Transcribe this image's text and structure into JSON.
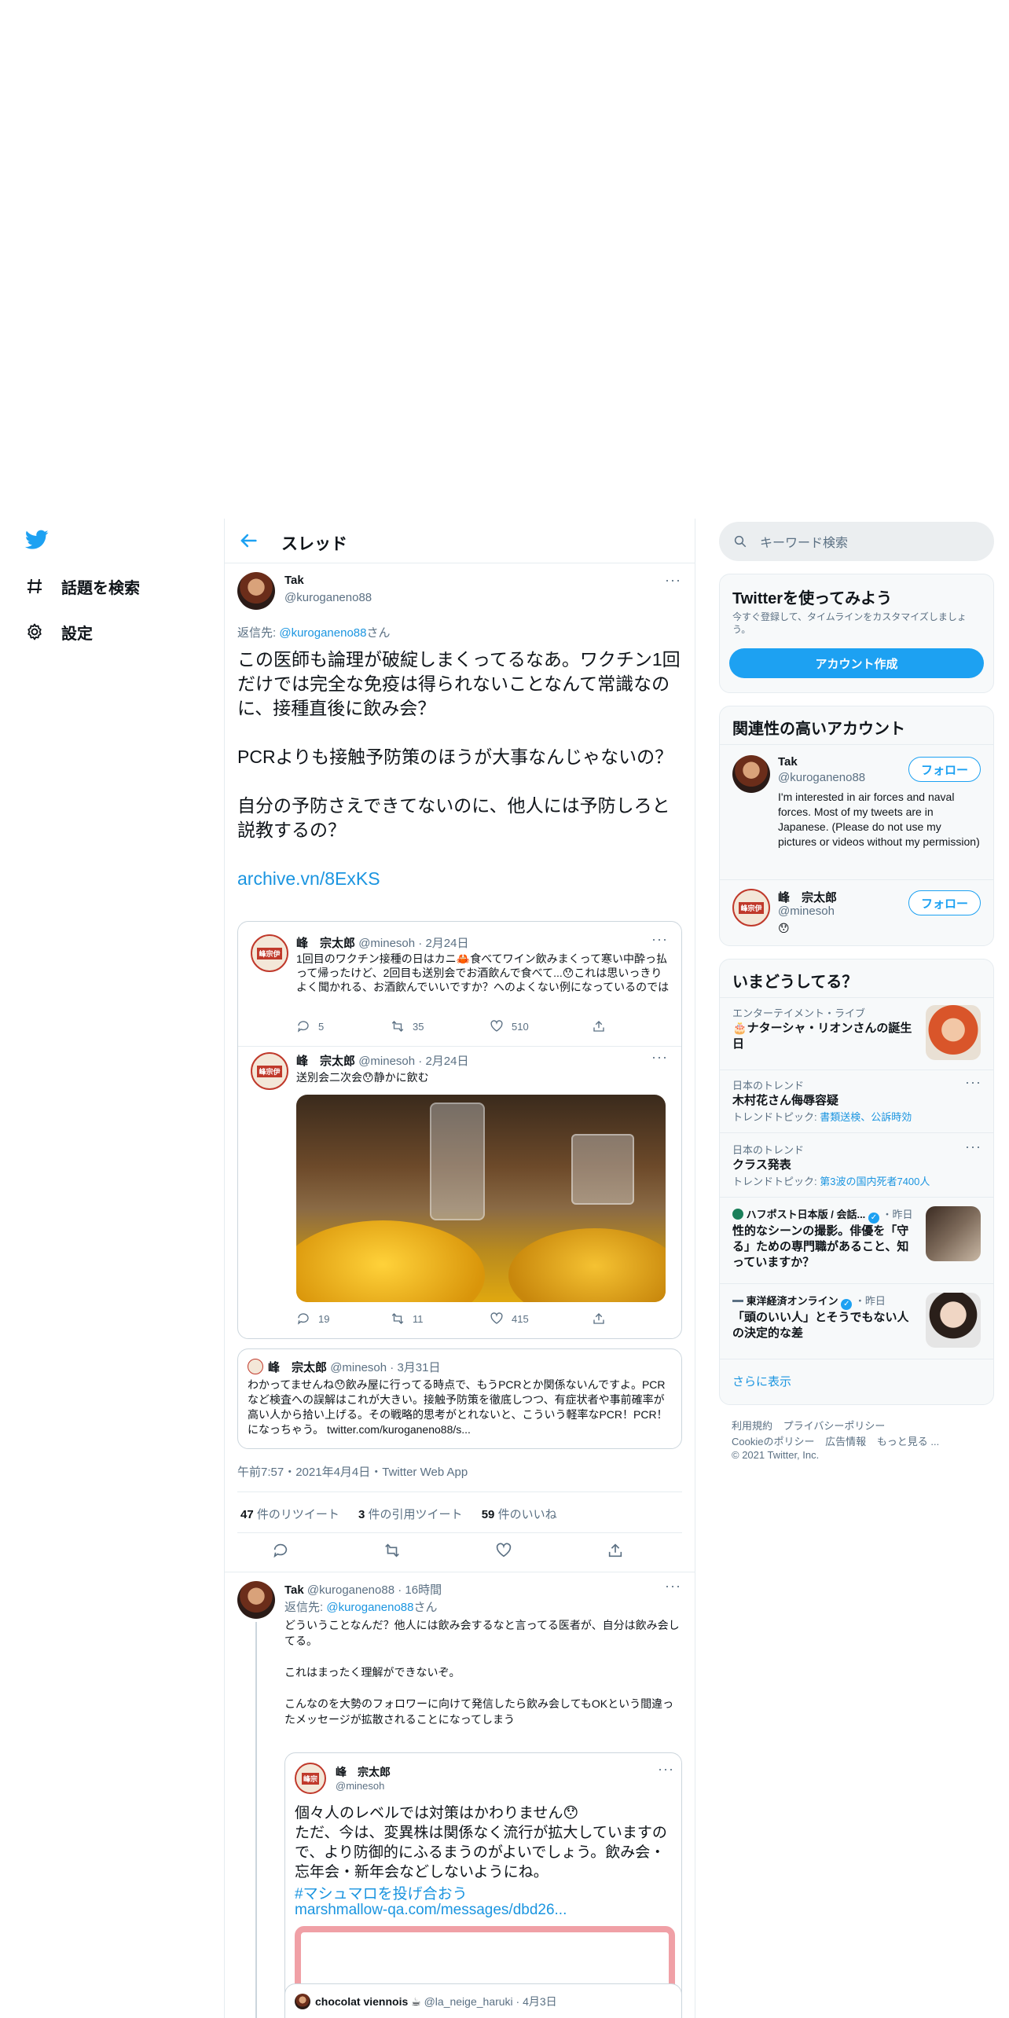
{
  "nav": {
    "items": [
      {
        "label": "話題を検索",
        "icon": "hashtag-icon"
      },
      {
        "label": "設定",
        "icon": "gear-icon"
      }
    ]
  },
  "header": {
    "title": "スレッド"
  },
  "main_tweet": {
    "name": "Tak",
    "handle": "@kuroganeno88",
    "reply_prefix": "返信先: ",
    "reply_to": "@kuroganeno88",
    "reply_suffix": "さん",
    "para1": "この医師も論理が破綻しまくってるなあ。ワクチン1回だけでは完全な免疫は得られないことなんて常識なのに、接種直後に飲み会？",
    "para2": "PCRよりも接触予防策のほうが大事なんじゃないの？",
    "para3": "自分の予防さえできてないのに、他人には予防しろと説教するの？",
    "link": "archive.vn/8ExKS",
    "timestamp": "午前7:57・2021年4月4日・Twitter Web App",
    "retweets_count": "47",
    "retweets_label": " 件のリツイート",
    "quotes_count": "3",
    "quotes_label": " 件の引用ツイート",
    "likes_count": "59",
    "likes_label": " 件のいいね"
  },
  "embedded_thread": [
    {
      "name": "峰　宗太郎",
      "handle": "@minesoh · 2月24日",
      "text": "1回目のワクチン接種の日はカニ🦀食べてワイン飲みまくって寒い中酔っ払って帰ったけど、2回目も送別会でお酒飲んで食べて...😯これは思いっきりよく聞かれる、お酒飲んでいいですか？へのよくない例になっているのでは",
      "replies": "5",
      "retweets": "35",
      "likes": "510"
    },
    {
      "name": "峰　宗太郎",
      "handle": "@minesoh · 2月24日",
      "text": "送別会二次会😯静かに飲む",
      "replies": "19",
      "retweets": "11",
      "likes": "415"
    }
  ],
  "quoted_tweet": {
    "name": "峰　宗太郎",
    "handle": "@minesoh · 3月31日",
    "text": "わかってませんね😯飲み屋に行ってる時点で、もうPCRとか関係ないんですよ。PCRなど検査への誤解はこれが大きい。接触予防策を徹底しつつ、有症状者や事前確率が高い人から拾い上げる。その戦略的思考がとれないと、こういう軽率なPCR！PCR！になっちゃう。 twitter.com/kuroganeno88/s..."
  },
  "reply_tweet": {
    "name": "Tak",
    "meta": "@kuroganeno88 · 16時間",
    "reply_prefix": "返信先: ",
    "reply_to": "@kuroganeno88",
    "reply_suffix": "さん",
    "para1": "どういうことなんだ？他人には飲み会するなと言ってる医者が、自分は飲み会してる。",
    "para2": "これはまったく理解ができないぞ。",
    "para3": "こんなのを大勢のフォロワーに向けて発信したら飲み会してもOKという間違ったメッセージが拡散されることになってしまう",
    "quote": {
      "name": "峰　宗太郎",
      "handle": "@minesoh",
      "text": "個々人のレベルでは対策はかわりません😯\nただ、今は、変異株は関係なく流行が拡大していますので、より防御的にふるまうのがよいでしょう。飲み会・忘年会・新年会などしないようにね。",
      "hashtag": "#マシュマロを投げ合おう",
      "link": "marshmallow-qa.com/messages/dbd26..."
    },
    "next_quote": {
      "name": "chocolat viennois ☕",
      "meta": "@la_neige_haruki · 4月3日"
    }
  },
  "search": {
    "placeholder": "キーワード検索"
  },
  "signup": {
    "title": "Twitterを使ってみよう",
    "desc": "今すぐ登録して、タイムラインをカスタマイズしましょう。",
    "button": "アカウント作成"
  },
  "related": {
    "title": "関連性の高いアカウント",
    "follow_label": "フォロー",
    "accounts": [
      {
        "name": "Tak",
        "handle": "@kuroganeno88",
        "bio": "I'm interested in air forces and naval forces. Most of my tweets are in Japanese. (Please do not use my pictures or videos without my permission)"
      },
      {
        "name": "峰　宗太郎",
        "handle": "@minesoh",
        "bio": "😯"
      }
    ]
  },
  "trends": {
    "title": "いまどうしてる？",
    "items": [
      {
        "category": "エンターテイメント・ライブ",
        "title": "🎂ナターシャ・リオンさんの誕生日"
      },
      {
        "category": "日本のトレンド",
        "title": "木村花さん侮辱容疑",
        "topic_label": "トレンドトピック: ",
        "topic": "書類送検、公訴時効"
      },
      {
        "category": "日本のトレンド",
        "title": "クラス発表",
        "topic_label": "トレンドトピック: ",
        "topic": "第3波の国内死者7400人"
      },
      {
        "source": "ハフポスト日本版 / 会話...",
        "time": "・昨日",
        "title": "性的なシーンの撮影。俳優を「守る」ための専門職があること、知っていますか？"
      },
      {
        "source": "東洋経済オンライン",
        "time": "・昨日",
        "title": "「頭のいい人」とそうでもない人の決定的な差"
      }
    ],
    "more": "さらに表示"
  },
  "footer": {
    "line1a": "利用規約",
    "line1b": "プライバシーポリシー",
    "line2a": "Cookieのポリシー",
    "line2b": "広告情報",
    "line2c": "もっと見る ...",
    "copyright": "© 2021 Twitter, Inc."
  },
  "colors": {
    "accent": "#1da1f2",
    "text": "#0f1419",
    "muted": "#5b7083",
    "border": "#e6ecf0"
  }
}
